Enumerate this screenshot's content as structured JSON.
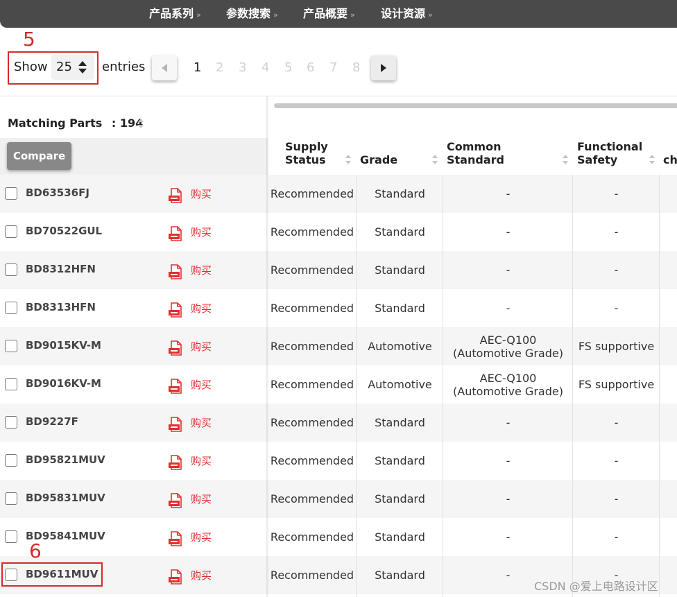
{
  "nav": {
    "items": [
      {
        "label": "产品系列"
      },
      {
        "label": "参数搜索"
      },
      {
        "label": "产品概要"
      },
      {
        "label": "设计资源"
      }
    ],
    "chevron": "»"
  },
  "length": {
    "show_label": "Show",
    "entries_label": "entries",
    "selected": "25"
  },
  "pagination": {
    "pages": [
      "1",
      "2",
      "3",
      "4",
      "5",
      "6",
      "7",
      "8"
    ],
    "current": "1"
  },
  "annotations": {
    "step5": "5",
    "step6": "6"
  },
  "table": {
    "matching_label": "Matching Parts",
    "matching_count": ": 194",
    "compare_label": "Compare",
    "columns": {
      "supply": [
        "Supply",
        "Status"
      ],
      "grade": "Grade",
      "common": [
        "Common",
        "Standard"
      ],
      "fs": [
        "Functional",
        "Safety"
      ],
      "next": "ch"
    },
    "buy_label": "购买",
    "rows": [
      {
        "part": "BD63536FJ",
        "supply": "Recommended",
        "grade": "Standard",
        "common": [
          "-"
        ],
        "fs": "-"
      },
      {
        "part": "BD70522GUL",
        "supply": "Recommended",
        "grade": "Standard",
        "common": [
          "-"
        ],
        "fs": "-"
      },
      {
        "part": "BD8312HFN",
        "supply": "Recommended",
        "grade": "Standard",
        "common": [
          "-"
        ],
        "fs": "-"
      },
      {
        "part": "BD8313HFN",
        "supply": "Recommended",
        "grade": "Standard",
        "common": [
          "-"
        ],
        "fs": "-"
      },
      {
        "part": "BD9015KV-M",
        "supply": "Recommended",
        "grade": "Automotive",
        "common": [
          "AEC-Q100",
          "(Automotive Grade)"
        ],
        "fs": "FS supportive"
      },
      {
        "part": "BD9016KV-M",
        "supply": "Recommended",
        "grade": "Automotive",
        "common": [
          "AEC-Q100",
          "(Automotive Grade)"
        ],
        "fs": "FS supportive"
      },
      {
        "part": "BD9227F",
        "supply": "Recommended",
        "grade": "Standard",
        "common": [
          "-"
        ],
        "fs": "-"
      },
      {
        "part": "BD95821MUV",
        "supply": "Recommended",
        "grade": "Standard",
        "common": [
          "-"
        ],
        "fs": "-"
      },
      {
        "part": "BD95831MUV",
        "supply": "Recommended",
        "grade": "Standard",
        "common": [
          "-"
        ],
        "fs": "-"
      },
      {
        "part": "BD95841MUV",
        "supply": "Recommended",
        "grade": "Standard",
        "common": [
          "-"
        ],
        "fs": "-"
      },
      {
        "part": "BD9611MUV",
        "supply": "Recommended",
        "grade": "Standard",
        "common": [
          "-"
        ],
        "fs": "-"
      }
    ]
  },
  "watermark": "CSDN @爱上电路设计区",
  "colors": {
    "nav_bg": "#4a4a4a",
    "annotation_red": "#d42b2b",
    "buy_red": "#e03030",
    "compare_bg": "#888888"
  },
  "icons": {
    "nav_chevron": "double-chevron-down-icon",
    "pdf": "pdf-icon",
    "sort": "sort-icon",
    "select_arrows": "select-arrows-icon",
    "prev": "prev-arrow-icon",
    "next": "next-arrow-icon"
  }
}
